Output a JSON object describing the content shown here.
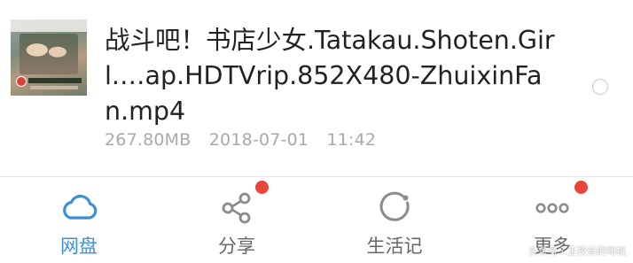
{
  "file": {
    "title": "战斗吧！书店少女.Tatakau.Shoten.Girl.…ap.HDTVrip.852X480-ZhuixinFan.mp4",
    "size": "267.80MB",
    "date": "2018-07-01",
    "time": "11:42",
    "thumbnail_icon": "video-thumbnail"
  },
  "tabs": [
    {
      "label": "网盘",
      "icon": "cloud-icon",
      "active": true,
      "badge": false
    },
    {
      "label": "分享",
      "icon": "share-icon",
      "active": false,
      "badge": true
    },
    {
      "label": "生活记",
      "icon": "circle-record-icon",
      "active": false,
      "badge": false
    },
    {
      "label": "更多",
      "icon": "more-dots-icon",
      "active": false,
      "badge": true
    }
  ],
  "watermark": "头条号 / 王校长的司机",
  "colors": {
    "accent": "#3e8ed8",
    "icon_inactive": "#8c8c8c",
    "badge": "#e8453c",
    "text_primary": "#222222",
    "text_meta": "#a9a9a9"
  }
}
